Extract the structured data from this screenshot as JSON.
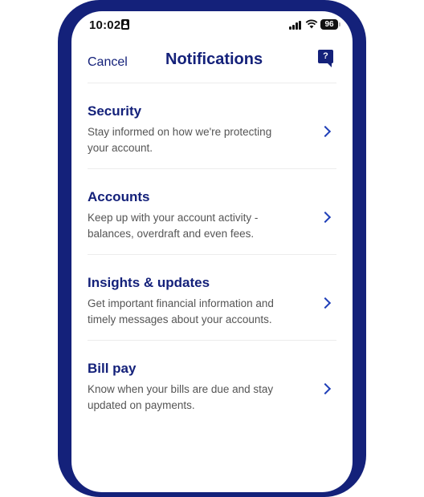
{
  "status_bar": {
    "time": "10:02",
    "battery": "96"
  },
  "header": {
    "cancel_label": "Cancel",
    "title": "Notifications",
    "help_label": "?"
  },
  "items": [
    {
      "title": "Security",
      "description": "Stay informed on how we're protecting your account."
    },
    {
      "title": "Accounts",
      "description": "Keep up with your account activity - balances, overdraft and even fees."
    },
    {
      "title": "Insights & updates",
      "description": "Get important financial information and timely messages about your accounts."
    },
    {
      "title": "Bill pay",
      "description": "Know when your bills are due and stay updated on payments."
    }
  ],
  "colors": {
    "brand": "#14217a",
    "chevron": "#1f3fb8",
    "body_text": "#555555"
  }
}
